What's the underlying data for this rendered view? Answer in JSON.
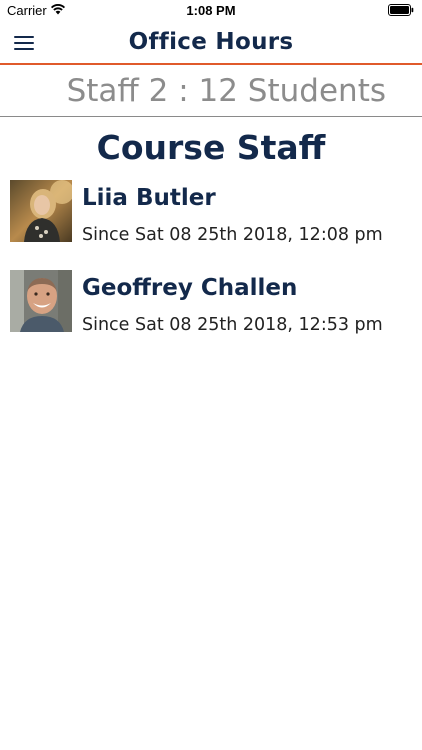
{
  "status_bar": {
    "carrier": "Carrier",
    "time": "1:08 PM",
    "icons": [
      "wifi-icon",
      "battery-icon"
    ]
  },
  "nav": {
    "title": "Office Hours",
    "menu_icon": "hamburger-menu-icon"
  },
  "counter": {
    "text": "Staff 2 : 12 Students"
  },
  "section": {
    "title": "Course Staff"
  },
  "staff": [
    {
      "name": "Liia Butler",
      "since": "Since Sat 08 25th 2018, 12:08 pm"
    },
    {
      "name": "Geoffrey Challen",
      "since": "Since Sat 08 25th 2018, 12:53 pm"
    }
  ],
  "colors": {
    "brand_navy": "#13294b",
    "accent_orange": "#e05a2b",
    "counter_gray": "#8c8c8c"
  }
}
